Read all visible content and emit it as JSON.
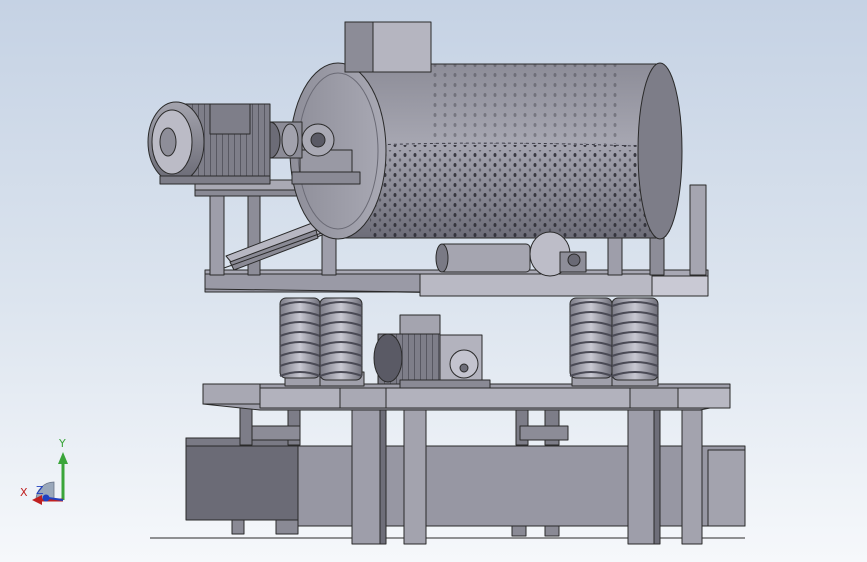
{
  "viewport": {
    "background_top": "#c5d2e4",
    "background_bottom": "#f6f8fb"
  },
  "model": {
    "parts": [
      "base-enclosure",
      "lower-frame",
      "upper-platform",
      "support-springs",
      "vibration-motor",
      "drum-motor",
      "coupling",
      "bearing-block",
      "perforated-drum",
      "inlet-hopper",
      "outlet-chute",
      "tension-roller"
    ],
    "colors": {
      "steel": "#9a9aa6",
      "steel_dark": "#5c5c68",
      "steel_light": "#bdbdc8",
      "edge": "#2a2a2a"
    }
  },
  "triad": {
    "x_label": "X",
    "y_label": "Y",
    "z_label": "Z",
    "x_color": "#c02020",
    "y_color": "#3aa53a",
    "z_color": "#2040c0"
  }
}
